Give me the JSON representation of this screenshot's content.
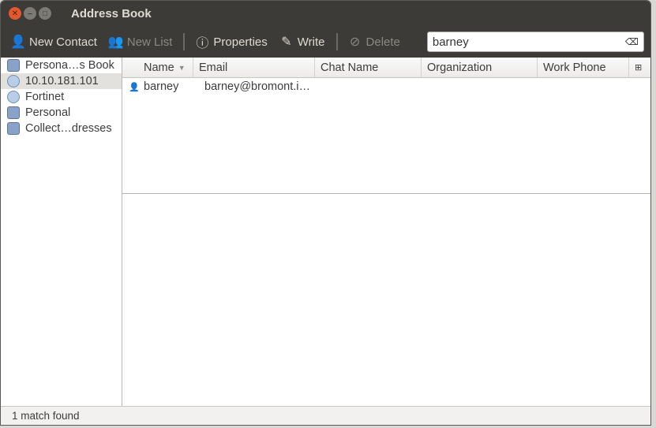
{
  "window": {
    "title": "Address Book"
  },
  "toolbar": {
    "new_contact": "New Contact",
    "new_list": "New List",
    "properties": "Properties",
    "write": "Write",
    "delete": "Delete"
  },
  "search": {
    "value": "barney"
  },
  "sidebar": {
    "items": [
      {
        "label": "Persona…s Book"
      },
      {
        "label": "10.10.181.101"
      },
      {
        "label": "Fortinet"
      },
      {
        "label": "Personal"
      },
      {
        "label": "Collect…dresses"
      }
    ]
  },
  "table": {
    "columns": [
      "Name",
      "Email",
      "Chat Name",
      "Organization",
      "Work Phone"
    ],
    "rows": [
      {
        "name": "barney",
        "email": "barney@bromont.i…"
      }
    ]
  },
  "status": "1 match found"
}
